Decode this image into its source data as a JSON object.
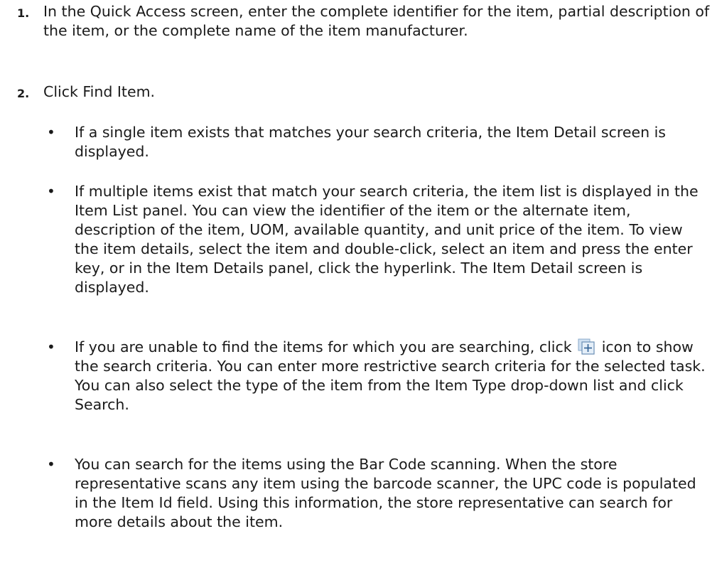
{
  "steps": [
    {
      "number": "1.",
      "text": "In the Quick Access screen, enter the complete identifier for the item, partial description of the item, or the complete name of the item manufacturer."
    },
    {
      "number": "2.",
      "text": "Click Find Item."
    }
  ],
  "bullets": [
    {
      "text": "If a single item exists that matches your search criteria, the Item Detail screen is displayed."
    },
    {
      "text": "If multiple items exist that match your search criteria, the item list is displayed in the Item List panel. You can view the identifier of the item or the alternate item, description of the item, UOM, available quantity, and unit price of the item. To view the item details, select the item and double-click, select an item and press the enter key, or in the Item Details panel, click the hyperlink. The Item Detail screen is displayed."
    },
    {
      "text_before_icon": "If you are unable to find the items for which you are searching, click",
      "icon": "expand-plus-icon",
      "text_after_icon": "icon to show the search criteria. You can enter more restrictive search criteria for the selected task. You can also select the type of the item from the Item Type drop-down list and click Search."
    },
    {
      "text": "You can search for the items using the Bar Code scanning. When the store representative scans any item using the barcode scanner, the UPC code is populated in the Item Id field. Using this information, the store representative can search for more details about the item."
    }
  ],
  "bullet_glyph": "•",
  "colors": {
    "text": "#1a1a1a",
    "icon_border": "#6b8fb5",
    "icon_fill": "#e4eef8",
    "icon_plus": "#2e5f93"
  }
}
